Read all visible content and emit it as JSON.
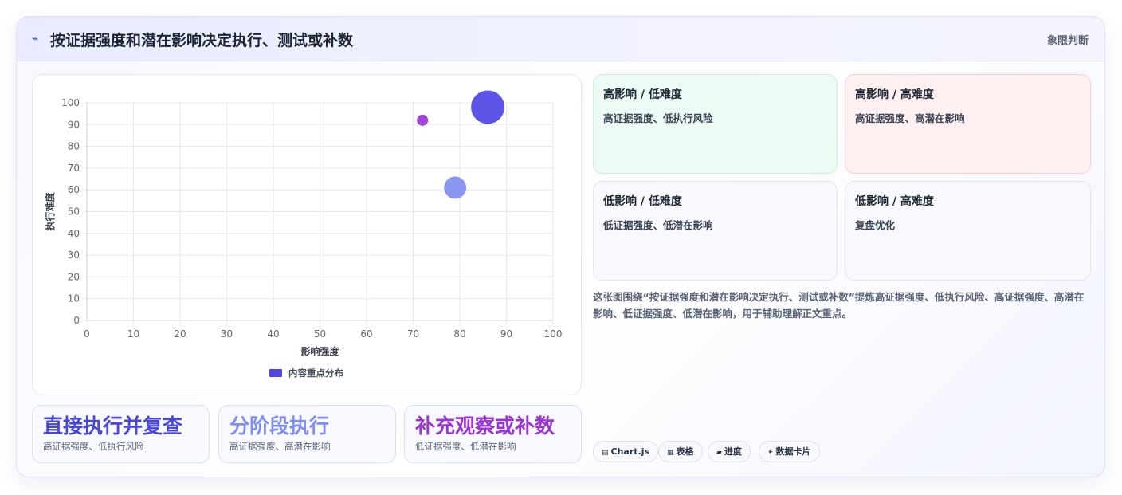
{
  "header": {
    "icon": "bolt-icon",
    "title": "按证据强度和潜在影响决定执行、测试或补数",
    "tag": "象限判断"
  },
  "chart_data": {
    "type": "bubble",
    "xlabel": "影响强度",
    "ylabel": "执行难度",
    "xlim": [
      0,
      100
    ],
    "ylim": [
      0,
      100
    ],
    "x_ticks": [
      "0",
      "10",
      "20",
      "30",
      "40",
      "50",
      "60",
      "70",
      "80",
      "90",
      "100"
    ],
    "y_ticks": [
      "0",
      "10",
      "20",
      "30",
      "40",
      "50",
      "60",
      "70",
      "80",
      "90",
      "100"
    ],
    "grid": true,
    "legend_position": "bottom",
    "series": [
      {
        "name": "内容重点分布",
        "color": "#4f46e5",
        "points": [
          {
            "x": 86,
            "y": 98,
            "r": 21,
            "color": "#4f46e5"
          },
          {
            "x": 79,
            "y": 61,
            "r": 14,
            "color": "#7f8ef0"
          },
          {
            "x": 72,
            "y": 92,
            "r": 7,
            "color": "#9a35d2"
          }
        ]
      }
    ]
  },
  "quadrants": [
    {
      "title": "高影响 / 低难度",
      "desc": "高证据强度、低执行风险"
    },
    {
      "title": "高影响 / 高难度",
      "desc": "高证据强度、高潜在影响"
    },
    {
      "title": "低影响 / 低难度",
      "desc": "低证据强度、低潜在影响"
    },
    {
      "title": "低影响 / 高难度",
      "desc": "复盘优化"
    }
  ],
  "description": "这张图围绕“按证据强度和潜在影响决定执行、测试或补数”提炼高证据强度、低执行风险、高证据强度、高潜在影响、低证据强度、低潜在影响，用于辅助理解正文重点。",
  "stats": [
    {
      "value": "直接执行并复查",
      "label": "高证据强度、低执行风险",
      "color": "#4a47d8"
    },
    {
      "value": "分阶段执行",
      "label": "高证据强度、高潜在影响",
      "color": "#7f8ef0"
    },
    {
      "value": "补充观察或补数",
      "label": "低证据强度、低潜在影响",
      "color": "#9a35d2"
    }
  ],
  "pills": [
    {
      "icon": "chart-icon",
      "glyph": "▤",
      "label": "Chart.js"
    },
    {
      "icon": "table-icon",
      "glyph": "▦",
      "label": "表格"
    },
    {
      "icon": "progress-icon",
      "glyph": "▰",
      "label": "进度"
    },
    {
      "icon": "data-card-icon",
      "glyph": "✦",
      "label": "数据卡片"
    }
  ]
}
